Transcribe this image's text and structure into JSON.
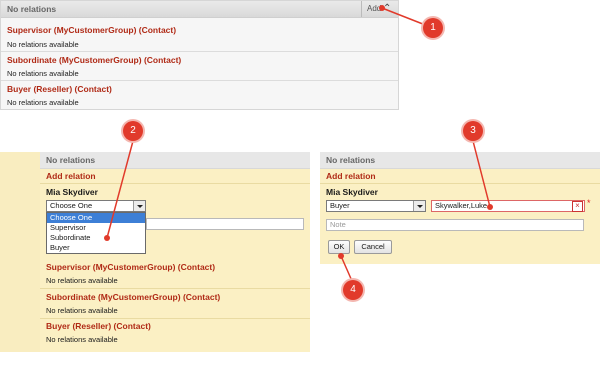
{
  "panel1": {
    "header": "No relations",
    "add_label": "Add",
    "rows": [
      {
        "title": "Supervisor (MyCustomerGroup) (Contact)",
        "text": "No relations available"
      },
      {
        "title": "Subordinate (MyCustomerGroup) (Contact)",
        "text": "No relations available"
      },
      {
        "title": "Buyer (Reseller) (Contact)",
        "text": "No relations available"
      }
    ]
  },
  "panel2": {
    "header": "No relations",
    "add_relation": "Add relation",
    "person": "Mia Skydiver",
    "select_value": "Choose One",
    "options": [
      "Choose One",
      "Supervisor",
      "Subordinate",
      "Buyer"
    ],
    "rows": [
      {
        "title": "Supervisor (MyCustomerGroup) (Contact)",
        "text": "No relations available"
      },
      {
        "title": "Subordinate (MyCustomerGroup) (Contact)",
        "text": "No relations available"
      },
      {
        "title": "Buyer (Reseller) (Contact)",
        "text": "No relations available"
      }
    ]
  },
  "panel3": {
    "header": "No relations",
    "add_relation": "Add relation",
    "person": "Mia Skydiver",
    "select_value": "Buyer",
    "contact_value": "Skywalker,Luke",
    "required_mark": "*",
    "note_placeholder": "Note",
    "ok_label": "OK",
    "cancel_label": "Cancel"
  },
  "callouts": [
    "1",
    "2",
    "3",
    "4"
  ],
  "colors": {
    "accent_red": "#b02a16",
    "callout_red": "#e13a2b",
    "panel_yellow": "#fbf0c4",
    "selection_blue": "#3d7fd6"
  }
}
